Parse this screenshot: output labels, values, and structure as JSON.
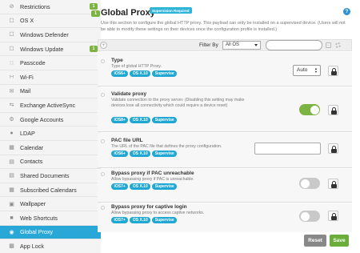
{
  "sidebar": {
    "items": [
      {
        "label": "Restrictions",
        "icon": "circle-slash-icon",
        "badge": "1"
      },
      {
        "label": "OS X",
        "icon": "checkbox-icon"
      },
      {
        "label": "Windows Defender",
        "icon": "checkbox-icon"
      },
      {
        "label": "Windows Update",
        "icon": "checkbox-icon",
        "badge": "1"
      },
      {
        "label": "Passcode",
        "icon": "keypad-icon"
      },
      {
        "label": "Wi-Fi",
        "icon": "wifi-icon"
      },
      {
        "label": "Mail",
        "icon": "mail-icon"
      },
      {
        "label": "Exchange ActiveSync",
        "icon": "sync-icon"
      },
      {
        "label": "Google Accounts",
        "icon": "gear-icon"
      },
      {
        "label": "LDAP",
        "icon": "person-icon"
      },
      {
        "label": "Calendar",
        "icon": "calendar-icon"
      },
      {
        "label": "Contacts",
        "icon": "contacts-icon"
      },
      {
        "label": "Shared Documents",
        "icon": "documents-icon"
      },
      {
        "label": "Subscribed Calendars",
        "icon": "calendar-icon"
      },
      {
        "label": "Wallpaper",
        "icon": "image-icon"
      },
      {
        "label": "Web Shortcuts",
        "icon": "bookmark-icon"
      },
      {
        "label": "Global Proxy",
        "icon": "globe-icon",
        "active": true
      },
      {
        "label": "App Lock",
        "icon": "lock-icon"
      }
    ]
  },
  "main": {
    "badge": "1",
    "title": "Global Proxy",
    "supervision_badge": "Supervision Required",
    "help": "?",
    "description": "Use this section to configure the global HTTP proxy. This payload can only be installed on a supervised device. (Users will not be able to modify these settings on their devices once the configuration profile is installed.)"
  },
  "filter": {
    "label": "Filter By",
    "value": "All OS",
    "search_placeholder": ""
  },
  "settings": [
    {
      "title": "Type",
      "description": "Type of global HTTP Proxy.",
      "tags": [
        "iOS6+",
        "OS X.10",
        "Supervise"
      ],
      "control": "select",
      "value": "Auto"
    },
    {
      "title": "Validate proxy",
      "description": "Validate connection to the proxy server. (Disabling this setting may make devices lose all connectivity which could require a device reset)",
      "tags": [
        "iOS8+",
        "OS X.10",
        "Supervise"
      ],
      "control": "toggle",
      "value": "on"
    },
    {
      "title": "PAC file URL",
      "description": "The URL of the PAC file that defines the proxy configuration.",
      "tags": [
        "iOS6+",
        "OS X.10",
        "Supervise"
      ],
      "control": "text",
      "value": ""
    },
    {
      "title": "Bypass proxy if PAC unreachable",
      "description": "Allow bypassing proxy if PAC is unreachable.",
      "tags": [
        "iOS7+",
        "OS X.10",
        "Supervise"
      ],
      "control": "toggle",
      "value": "off"
    },
    {
      "title": "Bypass proxy for captive login",
      "description": "Allow bypassing proxy to access captive networks.",
      "tags": [
        "iOS7+",
        "OS X.10",
        "Supervise"
      ],
      "control": "toggle",
      "value": "off"
    }
  ],
  "buttons": {
    "reset": "Reset",
    "save": "Save"
  },
  "colors": {
    "accent": "#29a8d8",
    "tag": "#21a7d3",
    "toggle_on": "#7cb342",
    "save": "#6aad3a",
    "reset": "#888888"
  }
}
